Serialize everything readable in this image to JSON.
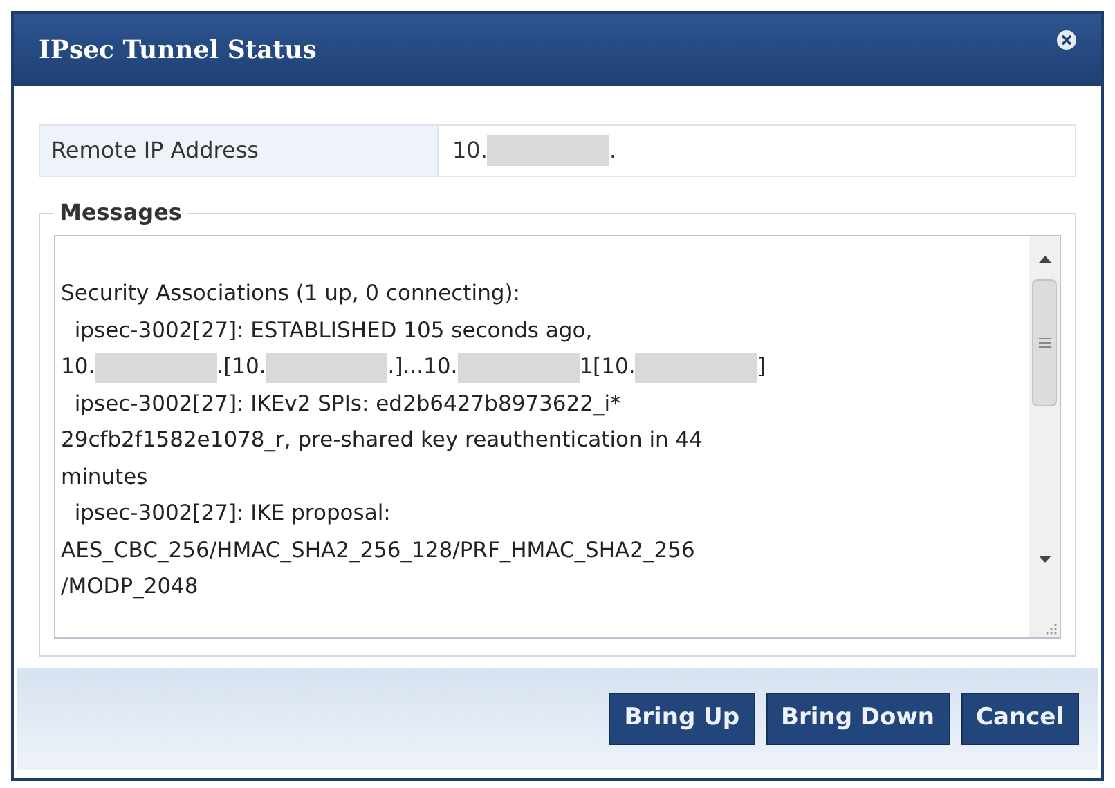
{
  "dialog": {
    "title": "IPsec Tunnel Status"
  },
  "remote_ip": {
    "label": "Remote IP Address",
    "value": [
      {
        "kind": "text",
        "text": "10."
      },
      {
        "kind": "redacted"
      },
      {
        "kind": "text",
        "text": "."
      }
    ]
  },
  "messages": {
    "legend": "Messages",
    "lines": [
      [
        {
          "kind": "text",
          "text": "Security Associations (1 up, 0 connecting):"
        }
      ],
      [
        {
          "kind": "text",
          "text": "  ipsec-3002[27]: ESTABLISHED 105 seconds ago,"
        }
      ],
      [
        {
          "kind": "text",
          "text": "10."
        },
        {
          "kind": "redacted"
        },
        {
          "kind": "text",
          "text": ".[10."
        },
        {
          "kind": "redacted"
        },
        {
          "kind": "text",
          "text": ".]...10."
        },
        {
          "kind": "redacted"
        },
        {
          "kind": "text",
          "text": "1[10."
        },
        {
          "kind": "redacted"
        },
        {
          "kind": "text",
          "text": "]"
        }
      ],
      [
        {
          "kind": "text",
          "text": "  ipsec-3002[27]: IKEv2 SPIs: ed2b6427b8973622_i*"
        }
      ],
      [
        {
          "kind": "text",
          "text": "29cfb2f1582e1078_r, pre-shared key reauthentication in 44"
        }
      ],
      [
        {
          "kind": "text",
          "text": "minutes"
        }
      ],
      [
        {
          "kind": "text",
          "text": "  ipsec-3002[27]: IKE proposal:"
        }
      ],
      [
        {
          "kind": "text",
          "text": "AES_CBC_256/HMAC_SHA2_256_128/PRF_HMAC_SHA2_256"
        }
      ],
      [
        {
          "kind": "text",
          "text": "/MODP_2048"
        }
      ]
    ]
  },
  "buttons": [
    "Bring Up",
    "Bring Down",
    "Cancel"
  ]
}
